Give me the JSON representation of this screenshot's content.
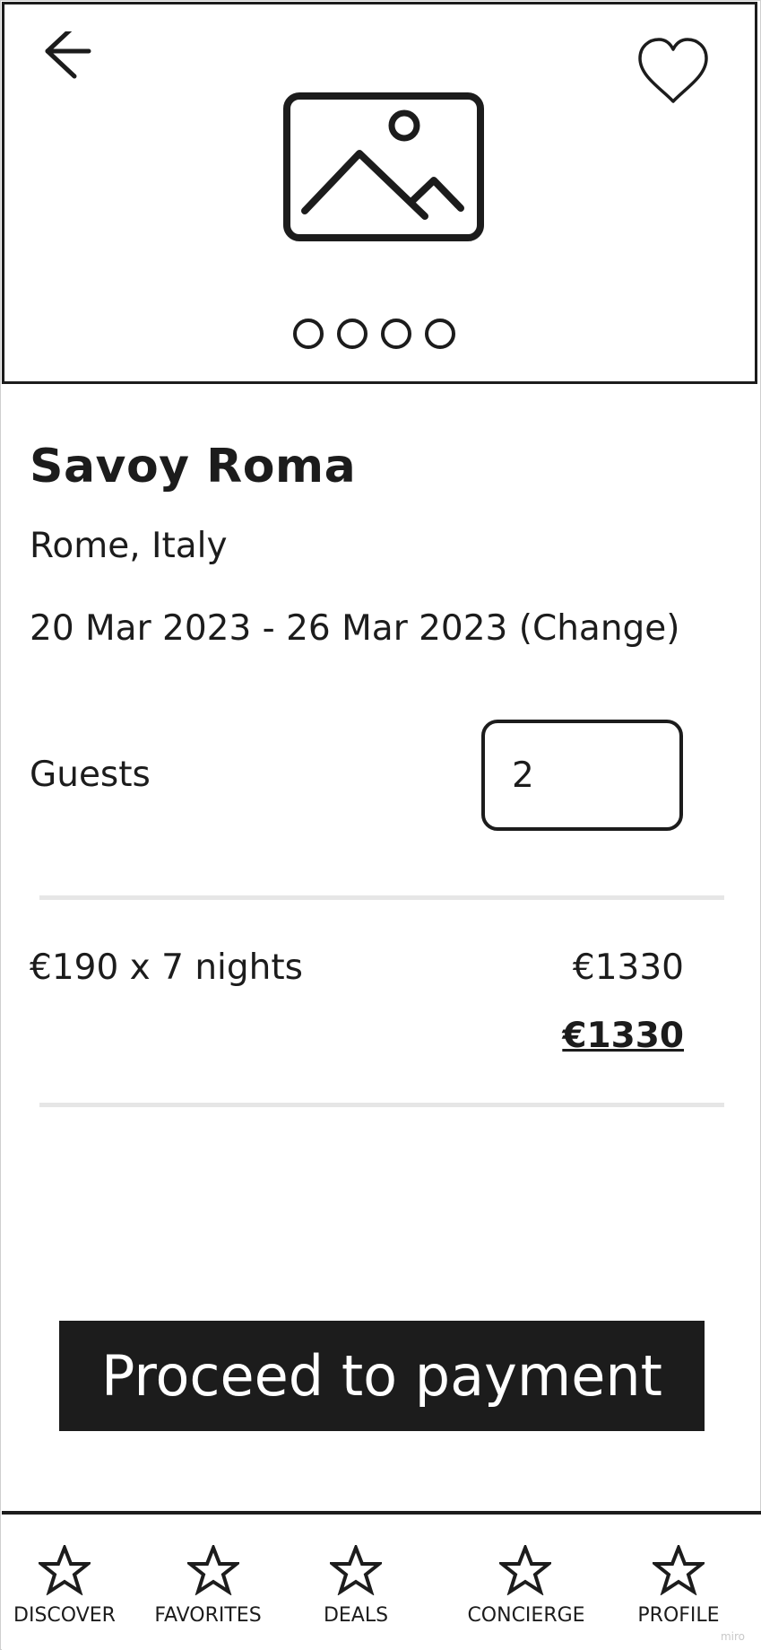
{
  "hotel": {
    "name": "Savoy Roma",
    "location": "Rome, Italy",
    "dates": "20 Mar 2023 - 26 Mar 2023 (Change)"
  },
  "gallery": {
    "indicator_count": 4,
    "icons": {
      "back": "arrow-left-icon",
      "favorite": "heart-outline-icon",
      "placeholder": "image-placeholder-icon"
    }
  },
  "guests": {
    "label": "Guests",
    "value": "2"
  },
  "pricing": {
    "description": "€190 x 7 nights",
    "subtotal": "€1330",
    "total": "€1330"
  },
  "cta": {
    "label": "Proceed to payment"
  },
  "nav": {
    "items": [
      {
        "label": "DISCOVER",
        "icon": "star-icon"
      },
      {
        "label": "FAVORITES",
        "icon": "star-icon"
      },
      {
        "label": "DEALS",
        "icon": "star-icon"
      },
      {
        "label": "CONCIERGE",
        "icon": "star-icon"
      },
      {
        "label": "PROFILE",
        "icon": "star-icon"
      }
    ]
  },
  "watermark": "miro",
  "colors": {
    "ink": "#1c1c1c",
    "divider": "#e6e6e6",
    "background": "#ffffff"
  }
}
